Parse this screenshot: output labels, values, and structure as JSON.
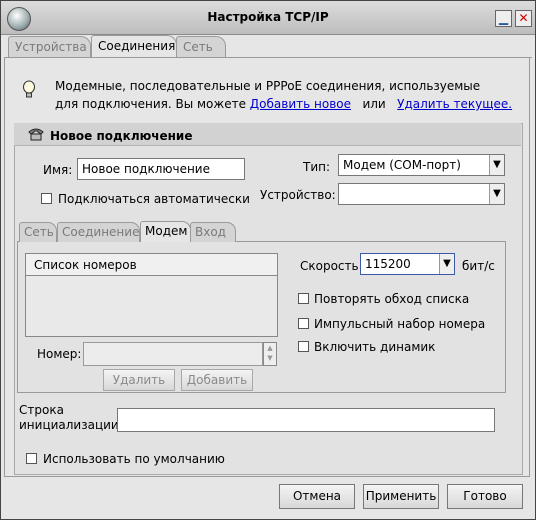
{
  "window": {
    "title": "Настройка TCP/IP"
  },
  "main_tabs": [
    "Устройства",
    "Соединения",
    "Сеть"
  ],
  "info": {
    "line1": "Модемные, последовательные и PPPoE соединения, используемые",
    "line2_prefix": "для подключения. Вы можете",
    "add_link": "Добавить новое",
    "or": "или",
    "remove_link": "Удалить текущее."
  },
  "connection": {
    "header": "Новое подключение",
    "name_label": "Имя:",
    "name_value": "Новое подключение",
    "auto_label": "Подключаться автоматически",
    "type_label": "Тип:",
    "type_value": "Модем (COM-порт)",
    "device_label": "Устройство:",
    "device_value": ""
  },
  "sub_tabs": [
    "Сеть",
    "Соединение",
    "Модем",
    "Вход"
  ],
  "modem": {
    "numbers_header": "Список номеров",
    "number_label": "Номер:",
    "number_value": "",
    "delete_label": "Удалить",
    "add_label": "Добавить",
    "speed_label": "Скорость:",
    "speed_value": "115200",
    "speed_unit": "бит/с",
    "repeat_label": "Повторять обход списка",
    "pulse_label": "Импульсный набор номера",
    "speaker_label": "Включить динамик",
    "init_label_1": "Строка",
    "init_label_2": "инициализации:",
    "init_value": ""
  },
  "default_label": "Использовать по умолчанию",
  "buttons": {
    "cancel": "Отмена",
    "apply": "Применить",
    "done": "Готово"
  }
}
